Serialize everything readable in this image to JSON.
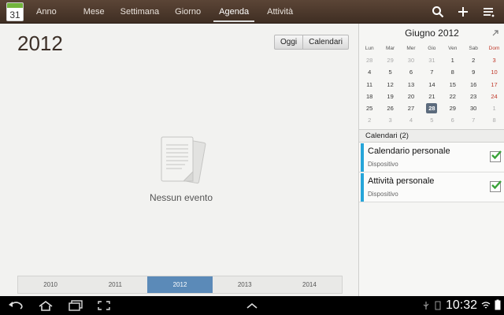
{
  "app": {
    "icon_number": "31"
  },
  "tabs": [
    {
      "label": "Anno"
    },
    {
      "label": "Mese"
    },
    {
      "label": "Settimana"
    },
    {
      "label": "Giorno"
    },
    {
      "label": "Agenda",
      "active": true
    },
    {
      "label": "Attività"
    }
  ],
  "top_actions": [
    "search-icon",
    "add-icon",
    "menu-icon"
  ],
  "main": {
    "year_title": "2012",
    "today_button": "Oggi",
    "calendars_button": "Calendari",
    "empty_text": "Nessun evento",
    "years": [
      "2010",
      "2011",
      "2012",
      "2013",
      "2014"
    ],
    "active_year": "2012"
  },
  "mini_calendar": {
    "title": "Giugno 2012",
    "weekdays": [
      "Lun",
      "Mar",
      "Mer",
      "Gio",
      "Ven",
      "Sab",
      "Dom"
    ],
    "weeks": [
      [
        "28",
        "29",
        "30",
        "31",
        "1",
        "2",
        "3"
      ],
      [
        "4",
        "5",
        "6",
        "7",
        "8",
        "9",
        "10"
      ],
      [
        "11",
        "12",
        "13",
        "14",
        "15",
        "16",
        "17"
      ],
      [
        "18",
        "19",
        "20",
        "21",
        "22",
        "23",
        "24"
      ],
      [
        "25",
        "26",
        "27",
        "28",
        "29",
        "30",
        "1"
      ],
      [
        "2",
        "3",
        "4",
        "5",
        "6",
        "7",
        "8"
      ]
    ],
    "today": "28"
  },
  "calendars": {
    "header": "Calendari",
    "count": "(2)",
    "items": [
      {
        "name": "Calendario personale",
        "sub": "Dispositivo",
        "checked": true
      },
      {
        "name": "Attività personale",
        "sub": "Dispositivo",
        "checked": true
      }
    ]
  },
  "status": {
    "time": "10:32"
  },
  "colors": {
    "accent": "#5b8ab8",
    "calendar_stripe": "#26a5d9",
    "topbar": "#4b372b",
    "today_cell": "#5c6b7d"
  }
}
